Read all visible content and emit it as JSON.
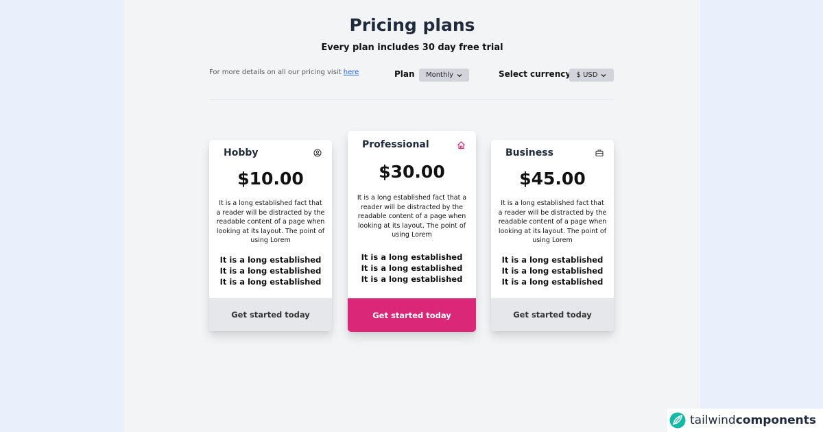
{
  "header": {
    "title": "Pricing plans",
    "subtitle": "Every plan includes 30 day free trial"
  },
  "controls": {
    "details_text": "For more details on all our pricing visit ",
    "details_link": "here",
    "plan_label": "Plan",
    "plan_value": "Monthly",
    "currency_label": "Select currency",
    "currency_value": "$ USD"
  },
  "plans": [
    {
      "name": "Hobby",
      "icon": "user-circle-icon",
      "price": "$10.00",
      "description": "It is a long established fact that a reader will be distracted by the readable content of a page when looking at its layout. The point of using Lorem",
      "features": [
        "It is a long established",
        "It is a long established",
        "It is a long established"
      ],
      "cta": "Get started today"
    },
    {
      "name": "Professional",
      "icon": "home-icon",
      "price": "$30.00",
      "description": "It is a long established fact that a reader will be distracted by the readable content of a page when looking at its layout. The point of using Lorem",
      "features": [
        "It is a long established",
        "It is a long established",
        "It is a long established"
      ],
      "cta": "Get started today"
    },
    {
      "name": "Business",
      "icon": "briefcase-icon",
      "price": "$45.00",
      "description": "It is a long established fact that a reader will be distracted by the readable content of a page when looking at its layout. The point of using Lorem",
      "features": [
        "It is a long established",
        "It is a long established",
        "It is a long established"
      ],
      "cta": "Get started today"
    }
  ],
  "colors": {
    "accent": "#db2777",
    "page_bg": "#f3f4f6",
    "outer_bg": "#e8f0fb"
  },
  "watermark": {
    "brand_light": "tailwind",
    "brand_bold": "components",
    "icon": "leaf-logo-icon"
  }
}
